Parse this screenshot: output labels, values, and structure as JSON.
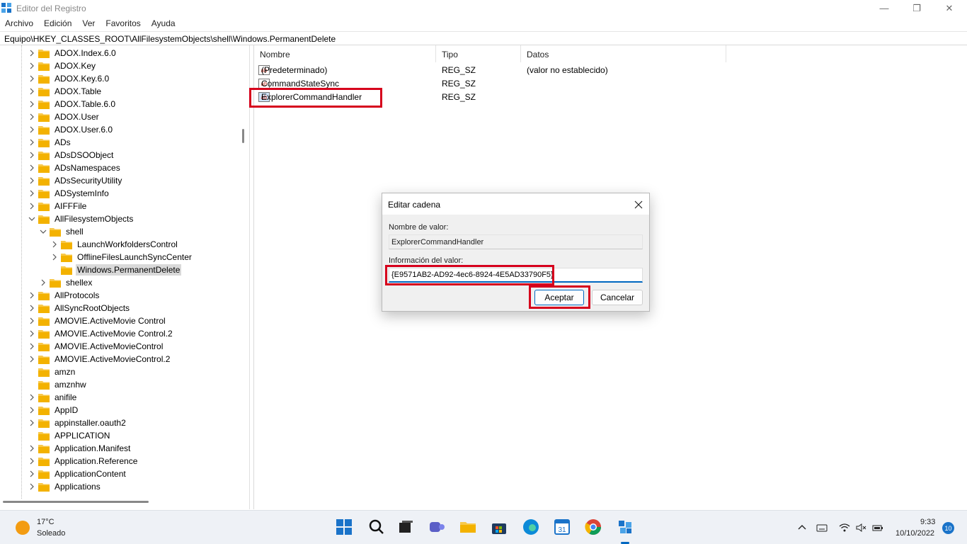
{
  "window": {
    "title": "Editor del Registro",
    "minimize": "—",
    "maximize": "❐",
    "close": "✕"
  },
  "menu": [
    "Archivo",
    "Edición",
    "Ver",
    "Favoritos",
    "Ayuda"
  ],
  "address": "Equipo\\HKEY_CLASSES_ROOT\\AllFilesystemObjects\\shell\\Windows.PermanentDelete",
  "tree": [
    {
      "label": "ADOX.Index.6.0",
      "level": 0,
      "expander": "collapsed"
    },
    {
      "label": "ADOX.Key",
      "level": 0,
      "expander": "collapsed"
    },
    {
      "label": "ADOX.Key.6.0",
      "level": 0,
      "expander": "collapsed"
    },
    {
      "label": "ADOX.Table",
      "level": 0,
      "expander": "collapsed"
    },
    {
      "label": "ADOX.Table.6.0",
      "level": 0,
      "expander": "collapsed"
    },
    {
      "label": "ADOX.User",
      "level": 0,
      "expander": "collapsed"
    },
    {
      "label": "ADOX.User.6.0",
      "level": 0,
      "expander": "collapsed"
    },
    {
      "label": "ADs",
      "level": 0,
      "expander": "collapsed"
    },
    {
      "label": "ADsDSOObject",
      "level": 0,
      "expander": "collapsed"
    },
    {
      "label": "ADsNamespaces",
      "level": 0,
      "expander": "collapsed"
    },
    {
      "label": "ADsSecurityUtility",
      "level": 0,
      "expander": "collapsed"
    },
    {
      "label": "ADSystemInfo",
      "level": 0,
      "expander": "collapsed"
    },
    {
      "label": "AIFFFile",
      "level": 0,
      "expander": "collapsed"
    },
    {
      "label": "AllFilesystemObjects",
      "level": 0,
      "expander": "expanded"
    },
    {
      "label": "shell",
      "level": 1,
      "expander": "expanded"
    },
    {
      "label": "LaunchWorkfoldersControl",
      "level": 2,
      "expander": "collapsed"
    },
    {
      "label": "OfflineFilesLaunchSyncCenter",
      "level": 2,
      "expander": "collapsed"
    },
    {
      "label": "Windows.PermanentDelete",
      "level": 2,
      "expander": "none",
      "selected": true
    },
    {
      "label": "shellex",
      "level": 1,
      "expander": "collapsed"
    },
    {
      "label": "AllProtocols",
      "level": 0,
      "expander": "collapsed"
    },
    {
      "label": "AllSyncRootObjects",
      "level": 0,
      "expander": "collapsed"
    },
    {
      "label": "AMOVIE.ActiveMovie Control",
      "level": 0,
      "expander": "collapsed"
    },
    {
      "label": "AMOVIE.ActiveMovie Control.2",
      "level": 0,
      "expander": "collapsed"
    },
    {
      "label": "AMOVIE.ActiveMovieControl",
      "level": 0,
      "expander": "collapsed"
    },
    {
      "label": "AMOVIE.ActiveMovieControl.2",
      "level": 0,
      "expander": "collapsed"
    },
    {
      "label": "amzn",
      "level": 0,
      "expander": "none"
    },
    {
      "label": "amznhw",
      "level": 0,
      "expander": "none"
    },
    {
      "label": "anifile",
      "level": 0,
      "expander": "collapsed"
    },
    {
      "label": "AppID",
      "level": 0,
      "expander": "collapsed"
    },
    {
      "label": "appinstaller.oauth2",
      "level": 0,
      "expander": "collapsed"
    },
    {
      "label": "APPLICATION",
      "level": 0,
      "expander": "none"
    },
    {
      "label": "Application.Manifest",
      "level": 0,
      "expander": "collapsed"
    },
    {
      "label": "Application.Reference",
      "level": 0,
      "expander": "collapsed"
    },
    {
      "label": "ApplicationContent",
      "level": 0,
      "expander": "collapsed"
    },
    {
      "label": "Applications",
      "level": 0,
      "expander": "collapsed"
    }
  ],
  "list": {
    "columns": [
      "Nombre",
      "Tipo",
      "Datos"
    ],
    "rows": [
      {
        "name": "(Predeterminado)",
        "type": "REG_SZ",
        "data": "(valor no establecido)",
        "icon": "string-value-icon"
      },
      {
        "name": "CommandStateSync",
        "type": "REG_SZ",
        "data": "",
        "icon": "string-value-icon"
      },
      {
        "name": "ExplorerCommandHandler",
        "type": "REG_SZ",
        "data": "",
        "icon": "string-value-icon",
        "selected": true
      }
    ]
  },
  "dialog": {
    "title": "Editar cadena",
    "close": "✕",
    "name_label": "Nombre de valor:",
    "name_value": "ExplorerCommandHandler",
    "data_label": "Información del valor:",
    "data_value": "{E9571AB2-AD92-4ec6-8924-4E5AD33790F5}",
    "ok": "Aceptar",
    "cancel": "Cancelar"
  },
  "taskbar": {
    "weather_temp": "17°C",
    "weather_cond": "Soleado",
    "time": "9:33",
    "date": "10/10/2022",
    "notifications": "10"
  },
  "colors": {
    "highlight_red": "#d6001c",
    "accent_blue": "#0067c0",
    "folder_yellow": "#f8c94a"
  }
}
